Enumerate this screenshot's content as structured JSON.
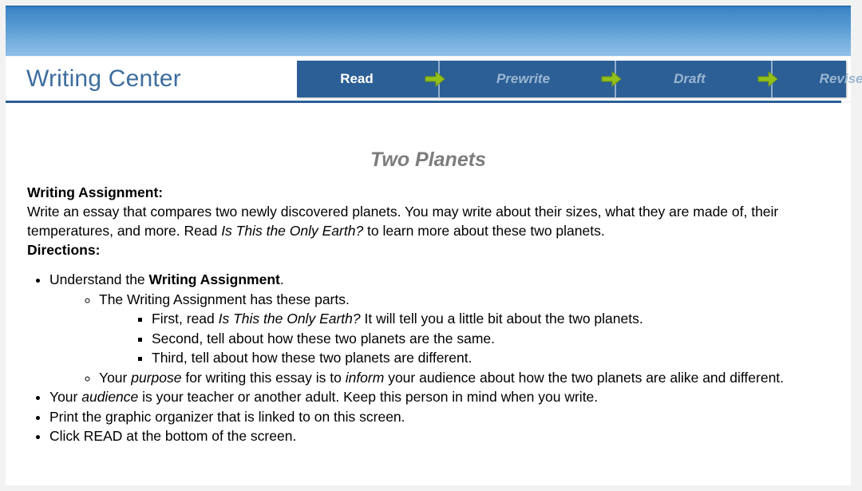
{
  "banner": {
    "name": "decorative-blue-banner"
  },
  "header": {
    "brand_title": "Writing Center",
    "steps": [
      {
        "label": "Read",
        "state": "active"
      },
      {
        "label": "Prewrite",
        "state": "inactive"
      },
      {
        "label": "Draft",
        "state": "inactive"
      },
      {
        "label": "Revise/Edit",
        "state": "inactive"
      }
    ],
    "arrow_icon_name": "arrow-right-icon"
  },
  "content": {
    "doc_title": "Two Planets",
    "assignment_label": "Writing Assignment:",
    "assignment_text_1": "Write an essay that compares two newly discovered planets. You may write about their sizes, what they are made of, their temperatures, and more. Read ",
    "assignment_book_title": "Is This the Only Earth?",
    "assignment_text_2": " to learn more about these two planets.",
    "directions_label": "Directions:",
    "bullets": {
      "b1_pre": "Understand the ",
      "b1_bold": "Writing Assignment",
      "b1_post": ".",
      "b1_sub1": "The Writing Assignment has these parts.",
      "b1_sub1_i1_pre": "First, read ",
      "b1_sub1_i1_ital": "Is This the Only Earth?",
      "b1_sub1_i1_post": " It will tell you a little bit about the two planets.",
      "b1_sub1_i2": "Second, tell about how these two planets are the same.",
      "b1_sub1_i3": "Third, tell about how these two planets are different.",
      "b1_sub2_pre": "Your ",
      "b1_sub2_ital1": "purpose",
      "b1_sub2_mid": " for writing this essay is to ",
      "b1_sub2_ital2": "inform",
      "b1_sub2_post": " your audience about how the two planets are alike and different.",
      "b2_pre": "Your ",
      "b2_ital": "audience",
      "b2_post": " is your teacher or another adult. Keep this person in mind when you write.",
      "b3": "Print the graphic organizer that is linked to on this screen.",
      "b4": "Click READ at the bottom of the screen."
    }
  },
  "colors": {
    "banner_top": "#2d7cc3",
    "banner_bottom": "#8fbfe9",
    "nav_bar": "#2c5f96",
    "brand_blue": "#3d6d9e",
    "arrow_green": "#93c119",
    "title_gray": "#7d7d7d",
    "inactive_step": "#9bb6d1"
  }
}
